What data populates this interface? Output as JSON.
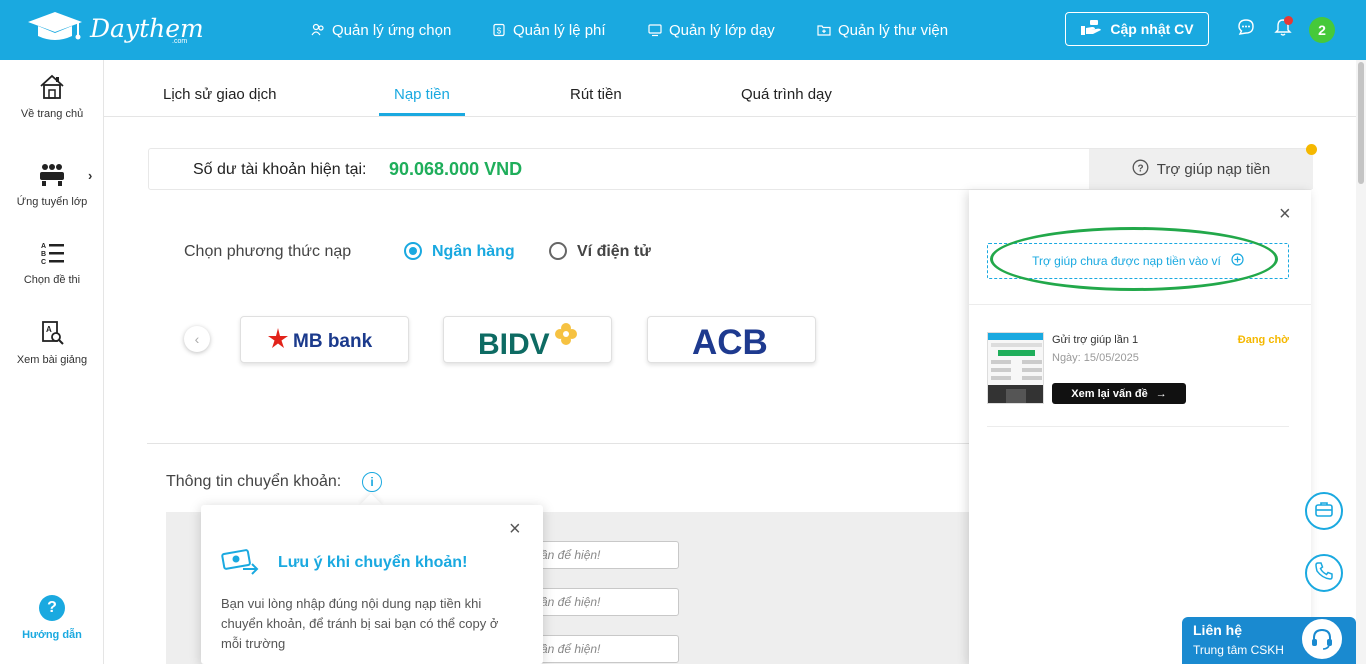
{
  "header": {
    "logo_text": "Daythem",
    "logo_sub": ".com",
    "nav": [
      {
        "label": "Quản lý ứng chọn",
        "icon": "users-icon"
      },
      {
        "label": "Quản lý lệ phí",
        "icon": "wallet-icon"
      },
      {
        "label": "Quản lý lớp dạy",
        "icon": "monitor-icon"
      },
      {
        "label": "Quản lý thư viện",
        "icon": "folder-icon"
      }
    ],
    "cv_button": "Cập nhật CV",
    "avatar_text": "2"
  },
  "sidebar": {
    "items": [
      {
        "label": "Về trang chủ",
        "icon": "home-icon"
      },
      {
        "label": "Ứng tuyển lớp",
        "icon": "classroom-icon"
      },
      {
        "label": "Chọn đề thi",
        "icon": "list-abc-icon"
      },
      {
        "label": "Xem bài giảng",
        "icon": "document-search-icon"
      }
    ],
    "guide_icon_text": "?",
    "guide_label": "Hướng dẫn"
  },
  "tabs": [
    {
      "label": "Lịch sử giao dịch",
      "active": false
    },
    {
      "label": "Nạp tiền",
      "active": true
    },
    {
      "label": "Rút tiền",
      "active": false
    },
    {
      "label": "Quá trình dạy",
      "active": false
    }
  ],
  "balance": {
    "label": "Số dư tài khoản hiện tại:",
    "value": "90.068.000 VND",
    "help_tab": "Trợ giúp nạp tiền"
  },
  "method": {
    "label": "Chọn phương thức nạp",
    "options": [
      {
        "label": "Ngân hàng",
        "selected": true
      },
      {
        "label": "Ví điện tử",
        "selected": false
      }
    ]
  },
  "banks": [
    {
      "name": "MB bank"
    },
    {
      "name": "BIDV"
    },
    {
      "name": "ACB"
    }
  ],
  "transfer": {
    "label": "Thông tin chuyển khoản:",
    "info_icon": "i",
    "field_placeholders": [
      "ần để hiện!",
      "ần để hiện!",
      "ần để hiện!"
    ]
  },
  "note_popup": {
    "title": "Lưu ý khi chuyển khoản!",
    "text": "Bạn vui lòng nhập đúng nội dung nạp tiền khi chuyển khoản, để tránh bị sai bạn có thể copy ở mỗi trường",
    "close": "×"
  },
  "help_panel": {
    "close": "×",
    "add_button": "Trợ giúp chưa được nạp tiền vào ví",
    "ticket": {
      "title": "Gửi trợ giúp lần 1",
      "date": "Ngày: 15/05/2025",
      "status": "Đang chờ",
      "button": "Xem lại vấn đề"
    }
  },
  "contact": {
    "title": "Liên hệ",
    "subtitle": "Trung tâm CSKH"
  },
  "colors": {
    "primary": "#1aa9e0",
    "balance_green": "#1fae5b",
    "pending": "#f5b800",
    "annotation": "#22a84a"
  }
}
